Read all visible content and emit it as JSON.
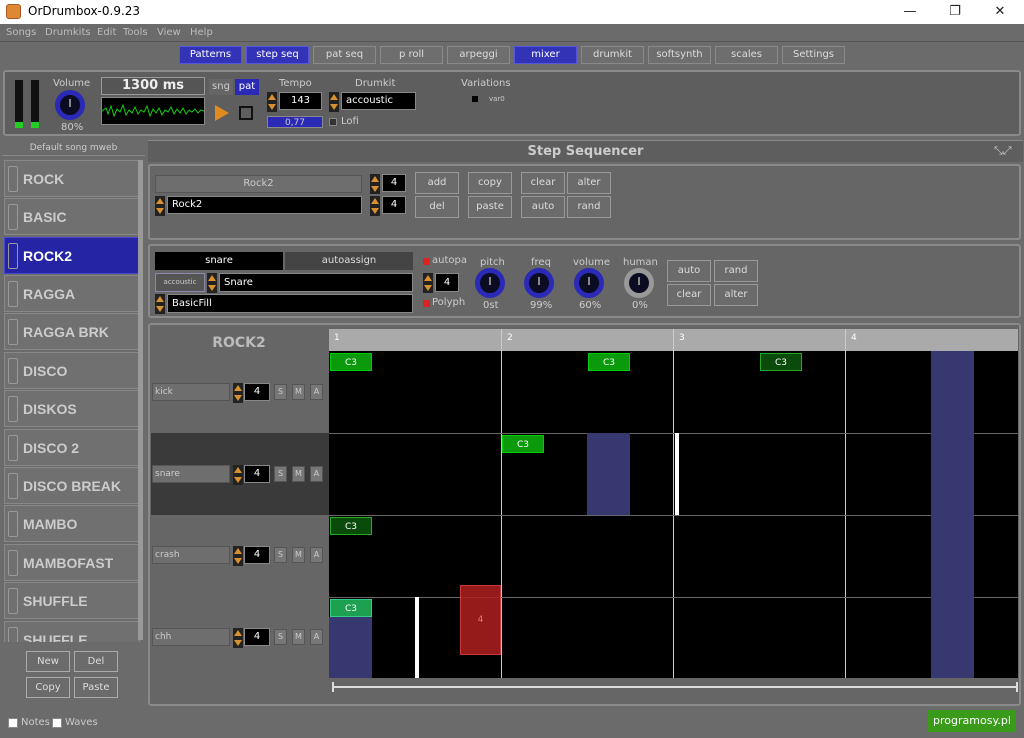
{
  "window": {
    "title": "OrDrumbox-0.9.23",
    "min": "—",
    "max": "❐",
    "close": "✕"
  },
  "menu": [
    "Songs",
    "Drumkits",
    "Edit",
    "Tools",
    "View",
    "Help"
  ],
  "tabs": [
    "Patterns",
    "step seq",
    "pat seq",
    "p roll",
    "arpeggi",
    "mixer",
    "drumkit",
    "softsynth",
    "scales",
    "Settings"
  ],
  "transport": {
    "volume_label": "Volume",
    "volume_value": "80%",
    "time_display": "1300 ms",
    "song_btn": "sng",
    "pattern_btn": "pat",
    "tempo_label": "Tempo",
    "tempo_value": "143",
    "swing_value": "0,77",
    "drumkit_label": "Drumkit",
    "drumkit_value": "accoustic",
    "lofi_label": "Lofi",
    "variations_label": "Variations",
    "variation_name": "var0"
  },
  "songlist": {
    "header": "Default song mweb",
    "items": [
      "ROCK",
      "BASIC",
      "ROCK2",
      "RAGGA",
      "RAGGA BRK",
      "DISCO",
      "DISKOS",
      "DISCO 2",
      "DISCO BREAK",
      "MAMBO",
      "MAMBOFAST",
      "SHUFFLE",
      "SHUFFLE BREAK"
    ],
    "active": "ROCK2"
  },
  "buttons": {
    "new": "New",
    "del": "Del",
    "copy": "Copy",
    "paste": "Paste"
  },
  "footer": {
    "notes": "Notes",
    "waves": "Waves",
    "brand": "programosy.pl"
  },
  "stepseq": {
    "title": "Step Sequencer",
    "pattern_label": "Rock2",
    "pattern_name": "Rock2",
    "steps": "4",
    "beats": "4",
    "buttons": [
      "add",
      "copy",
      "clear",
      "alter",
      "del",
      "paste",
      "auto",
      "rand"
    ]
  },
  "instrument": {
    "name": "snare",
    "autoassign": "autoassign",
    "kit": "accoustic",
    "sound": "Snare",
    "fill": "BasicFill",
    "autopan": "autopa",
    "polyph": "Polyph",
    "poly_value": "4",
    "knobs": [
      {
        "label": "pitch",
        "value": "0st"
      },
      {
        "label": "freq",
        "value": "99%"
      },
      {
        "label": "volume",
        "value": "60%"
      },
      {
        "label": "human",
        "value": "0%"
      }
    ],
    "buttons": [
      "auto",
      "rand",
      "clear",
      "alter"
    ]
  },
  "grid": {
    "pattern": "ROCK2",
    "bars": [
      "1",
      "2",
      "3",
      "4"
    ],
    "tracks": [
      {
        "name": "kick",
        "value": "4"
      },
      {
        "name": "snare",
        "value": "4"
      },
      {
        "name": "crash",
        "value": "4"
      },
      {
        "name": "chh",
        "value": "4"
      }
    ],
    "track_btns": [
      "S",
      "M",
      "A"
    ],
    "note": "C3",
    "selection_label": "4"
  }
}
